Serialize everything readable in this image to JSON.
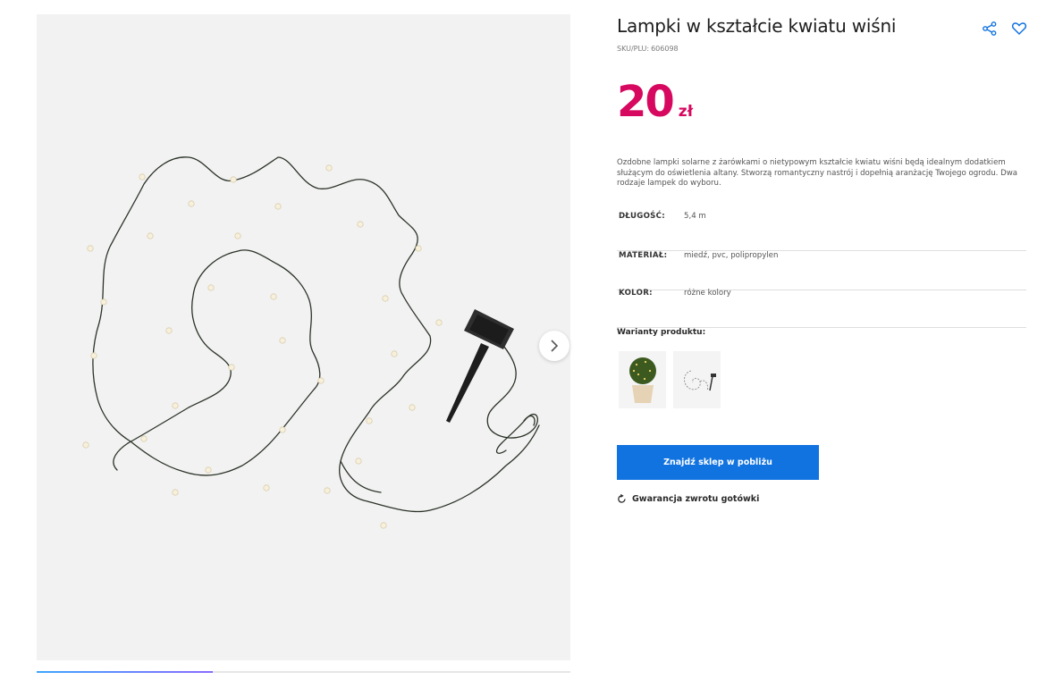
{
  "product": {
    "title": "Lampki w kształcie kwiatu wiśni",
    "sku_label": "SKU/PLU:",
    "sku": "606098",
    "price_value": "20",
    "price_currency": "zł",
    "description": "Ozdobne lampki solarne z żarówkami o nietypowym kształcie kwiatu wiśni będą idealnym dodatkiem służącym do oświetlenia altany. Stworzą romantyczny nastrój i dopełnią aranżację Twojego ogrodu. Dwa rodzaje lampek do wyboru.",
    "attributes": [
      {
        "key": "DŁUGOŚĆ:",
        "value": "5,4 m"
      },
      {
        "key": "MATERIAŁ:",
        "value": "miedź, pvc, polipropylen"
      },
      {
        "key": "KOLOR:",
        "value": "różne kolory"
      }
    ],
    "variants_label": "Warianty produktu:",
    "variants": [
      {
        "icon": "topiary-lights-thumbnail"
      },
      {
        "icon": "blossom-string-lights-thumbnail"
      }
    ]
  },
  "actions": {
    "find_store_label": "Znajdź sklep w pobliżu",
    "guarantee_label": "Gwarancja zwrotu gotówki"
  },
  "gallery": {
    "image": "solar-cherry-blossom-string-lights",
    "next_icon": "chevron-right-icon",
    "progress_fraction": 0.33
  },
  "colors": {
    "price": "#d6085f",
    "primary_button": "#1173e0",
    "icons": "#1173e0",
    "gallery_bg": "#f2f2f2"
  }
}
